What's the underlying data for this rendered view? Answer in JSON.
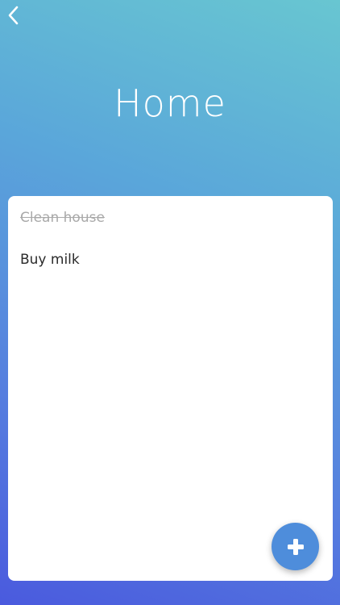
{
  "header": {
    "title": "Home",
    "back_icon": "chevron-left-icon"
  },
  "tasks": [
    {
      "label": "Clean house",
      "completed": true
    },
    {
      "label": "Buy milk",
      "completed": false
    }
  ],
  "fab": {
    "icon": "plus-icon"
  },
  "colors": {
    "gradient_top": "#68c6d1",
    "gradient_bottom": "#4a5ade",
    "fab": "#4e8ddb",
    "completed_text": "#a9a9a9",
    "text": "#2b2b2b"
  }
}
